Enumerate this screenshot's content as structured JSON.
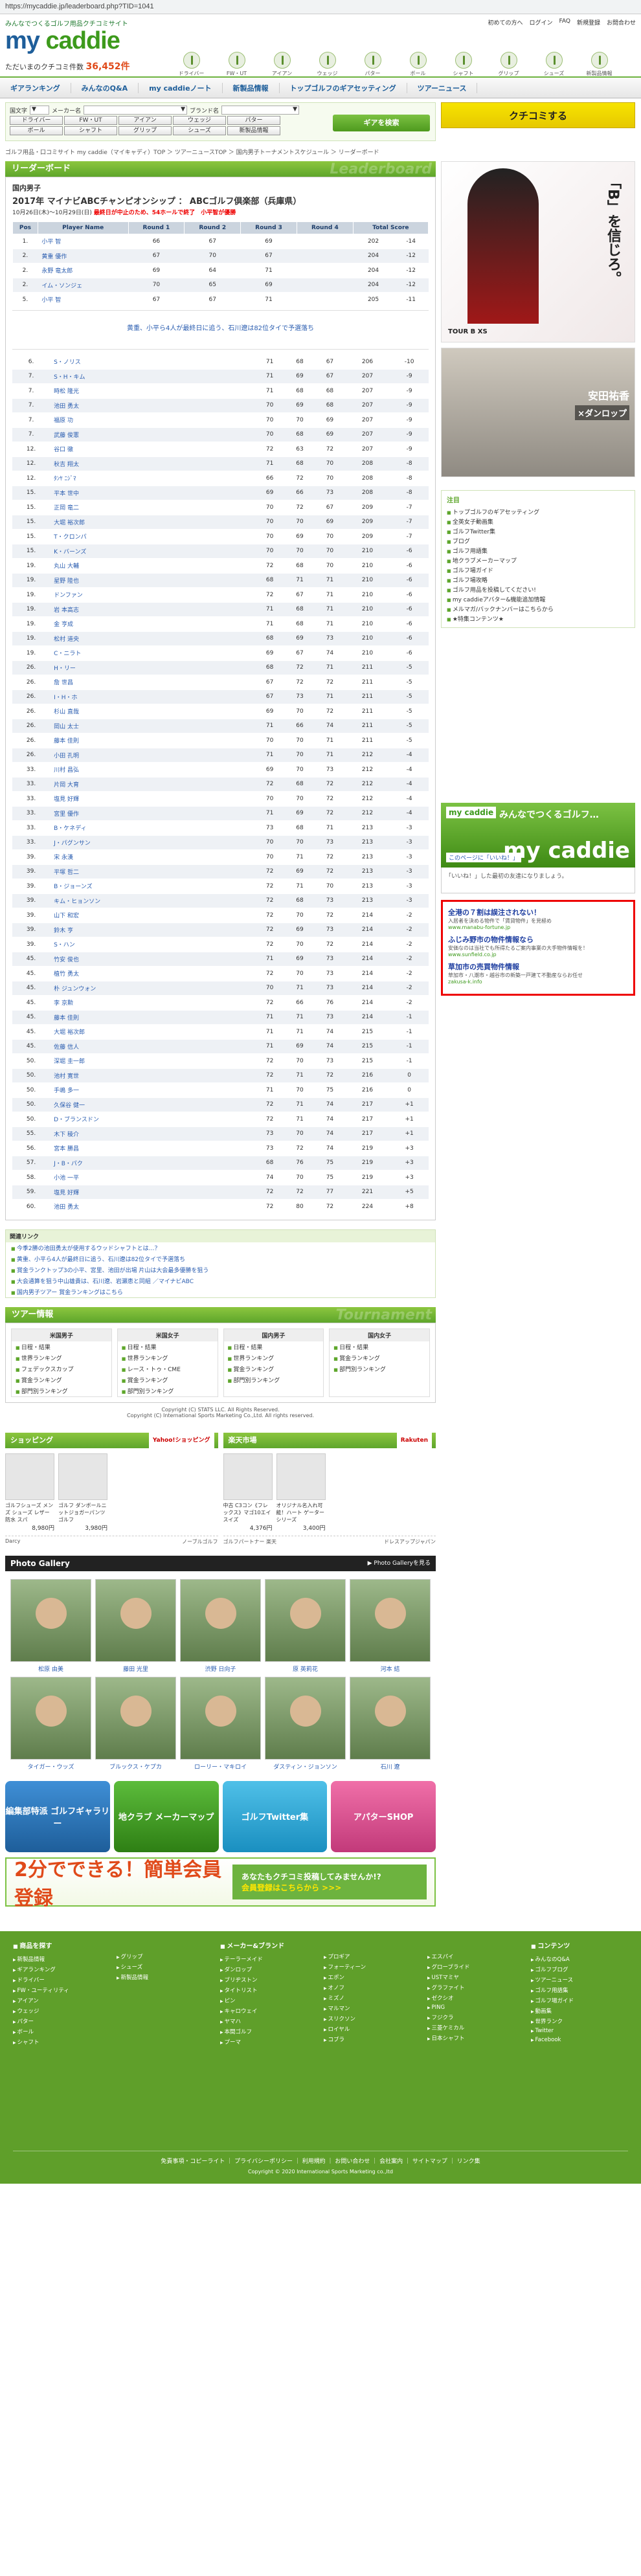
{
  "url": "https://mycaddie.jp/leaderboard.php?TID=1041",
  "header": {
    "tagline": "みんなでつくるゴルフ用品クチコミサイト",
    "logo_a": "my",
    "logo_b": "caddie",
    "posts_label": "ただいまのクチコミ件数",
    "posts_count": "36,452件",
    "toplinks": [
      "初めての方へ",
      "ログイン",
      "FAQ",
      "新規登録",
      "お問合わせ"
    ],
    "cats": [
      "ドライバー",
      "FW・UT",
      "アイアン",
      "ウェッジ",
      "パター",
      "ボール",
      "シャフト",
      "グリップ",
      "シューズ",
      "新製品情報"
    ]
  },
  "nav": [
    "ギアランキング",
    "みんなのQ&A",
    "my caddieノート",
    "新製品情報",
    "トップゴルフのギアセッティング",
    "ツアーニュース"
  ],
  "search": {
    "brand_label": "国文字",
    "maker_label": "メーカー名",
    "brand2_label": "ブランド名",
    "cats": [
      "ドライバー",
      "FW・UT",
      "アイアン",
      "ウェッジ",
      "パター",
      "ボール",
      "シャフト",
      "グリップ",
      "シューズ",
      "新製品情報"
    ],
    "gear_btn": "ギアを検索",
    "kuchi_btn": "クチコミする"
  },
  "breadcrumb": "ゴルフ用品・口コミサイト my caddie（マイキャディ）TOP ＞ ツアーニュースTOP ＞ 国内男子トーナメントスケジュール ＞ リーダーボード",
  "lb": {
    "title": "リーダーボード",
    "ghost": "Leaderboard",
    "tour": "国内男子",
    "event": "2017年 マイナビABCチャンピオンシップ ： ABCゴルフ倶楽部（兵庫県）",
    "date": "10月26日(木)～10月29日(日)",
    "date_note": "最終日が中止のため、54ホールで終了　小平智が優勝",
    "cols": [
      "Pos",
      "Player Name",
      "Round 1",
      "Round 2",
      "Round 3",
      "Round 4",
      "Total Score"
    ],
    "rows_top": [
      [
        "1.",
        "小平 智",
        "66",
        "67",
        "69",
        "",
        "202",
        "-14"
      ],
      [
        "2.",
        "黄重 優作",
        "67",
        "70",
        "67",
        "",
        "204",
        "-12"
      ],
      [
        "2.",
        "永野 竜太郎",
        "69",
        "64",
        "71",
        "",
        "204",
        "-12"
      ],
      [
        "2.",
        "イム・ソンジェ",
        "70",
        "65",
        "69",
        "",
        "204",
        "-12"
      ],
      [
        "5.",
        "小平 智",
        "67",
        "67",
        "71",
        "",
        "205",
        "-11"
      ]
    ],
    "note": "黄重、小平ら4人が最終日に追う、石川遼は82位タイで予選落ち",
    "rows": [
      [
        "6.",
        "S・ノリス",
        "71",
        "68",
        "67",
        "",
        "206",
        "-10"
      ],
      [
        "7.",
        "S・H・キム",
        "71",
        "69",
        "67",
        "",
        "207",
        "-9"
      ],
      [
        "7.",
        "時松 隆光",
        "71",
        "68",
        "68",
        "",
        "207",
        "-9"
      ],
      [
        "7.",
        "池田 勇太",
        "70",
        "69",
        "68",
        "",
        "207",
        "-9"
      ],
      [
        "7.",
        "福原 功",
        "70",
        "70",
        "69",
        "",
        "207",
        "-9"
      ],
      [
        "7.",
        "武藤 俊憲",
        "70",
        "68",
        "69",
        "",
        "207",
        "-9"
      ],
      [
        "12.",
        "谷口 徹",
        "72",
        "63",
        "72",
        "",
        "207",
        "-9"
      ],
      [
        "12.",
        "秋吉 翔太",
        "71",
        "68",
        "70",
        "",
        "208",
        "-8"
      ],
      [
        "12.",
        "ﾀﾝﾔ ﾆｼﾞﾏ",
        "66",
        "72",
        "70",
        "",
        "208",
        "-8"
      ],
      [
        "15.",
        "平本 世中",
        "69",
        "66",
        "73",
        "",
        "208",
        "-8"
      ],
      [
        "15.",
        "正岡 竜二",
        "70",
        "72",
        "67",
        "",
        "209",
        "-7"
      ],
      [
        "15.",
        "大堀 裕次郎",
        "70",
        "70",
        "69",
        "",
        "209",
        "-7"
      ],
      [
        "15.",
        "T・クロンパ",
        "70",
        "69",
        "70",
        "",
        "209",
        "-7"
      ],
      [
        "15.",
        "K・バーンズ",
        "70",
        "70",
        "70",
        "",
        "210",
        "-6"
      ],
      [
        "19.",
        "丸山 大輔",
        "72",
        "68",
        "70",
        "",
        "210",
        "-6"
      ],
      [
        "19.",
        "星野 陸也",
        "68",
        "71",
        "71",
        "",
        "210",
        "-6"
      ],
      [
        "19.",
        "ドンファン",
        "72",
        "67",
        "71",
        "",
        "210",
        "-6"
      ],
      [
        "19.",
        "岩 本高志",
        "71",
        "68",
        "71",
        "",
        "210",
        "-6"
      ],
      [
        "19.",
        "金 亨成",
        "71",
        "68",
        "71",
        "",
        "210",
        "-6"
      ],
      [
        "19.",
        "松村 道央",
        "68",
        "69",
        "73",
        "",
        "210",
        "-6"
      ],
      [
        "19.",
        "C・ニラト",
        "69",
        "67",
        "74",
        "",
        "210",
        "-6"
      ],
      [
        "26.",
        "H・リー",
        "68",
        "72",
        "71",
        "",
        "211",
        "-5"
      ],
      [
        "26.",
        "詹 世昌",
        "67",
        "72",
        "72",
        "",
        "211",
        "-5"
      ],
      [
        "26.",
        "I・H・ホ",
        "67",
        "73",
        "71",
        "",
        "211",
        "-5"
      ],
      [
        "26.",
        "杉山 直哉",
        "69",
        "70",
        "72",
        "",
        "211",
        "-5"
      ],
      [
        "26.",
        "岡山 太士",
        "71",
        "66",
        "74",
        "",
        "211",
        "-5"
      ],
      [
        "26.",
        "藤本 佳則",
        "70",
        "70",
        "71",
        "",
        "211",
        "-5"
      ],
      [
        "26.",
        "小田 孔明",
        "71",
        "70",
        "71",
        "",
        "212",
        "-4"
      ],
      [
        "33.",
        "川村 昌弘",
        "69",
        "70",
        "73",
        "",
        "212",
        "-4"
      ],
      [
        "33.",
        "片岡 大育",
        "72",
        "68",
        "72",
        "",
        "212",
        "-4"
      ],
      [
        "33.",
        "塩見 好輝",
        "70",
        "70",
        "72",
        "",
        "212",
        "-4"
      ],
      [
        "33.",
        "宮里 優作",
        "71",
        "69",
        "72",
        "",
        "212",
        "-4"
      ],
      [
        "33.",
        "B・ケネディ",
        "73",
        "68",
        "71",
        "",
        "213",
        "-3"
      ],
      [
        "33.",
        "J・パグンサン",
        "70",
        "70",
        "73",
        "",
        "213",
        "-3"
      ],
      [
        "39.",
        "宋 永漢",
        "70",
        "71",
        "72",
        "",
        "213",
        "-3"
      ],
      [
        "39.",
        "平塚 哲二",
        "72",
        "69",
        "72",
        "",
        "213",
        "-3"
      ],
      [
        "39.",
        "B・ジョーンズ",
        "72",
        "71",
        "70",
        "",
        "213",
        "-3"
      ],
      [
        "39.",
        "キム・ヒョンソン",
        "72",
        "68",
        "73",
        "",
        "213",
        "-3"
      ],
      [
        "39.",
        "山下 和宏",
        "72",
        "70",
        "72",
        "",
        "214",
        "-2"
      ],
      [
        "39.",
        "鈴木 亨",
        "72",
        "69",
        "73",
        "",
        "214",
        "-2"
      ],
      [
        "39.",
        "S・ハン",
        "72",
        "70",
        "72",
        "",
        "214",
        "-2"
      ],
      [
        "45.",
        "竹安 俊也",
        "71",
        "69",
        "73",
        "",
        "214",
        "-2"
      ],
      [
        "45.",
        "植竹 勇太",
        "72",
        "70",
        "73",
        "",
        "214",
        "-2"
      ],
      [
        "45.",
        "朴 ジュンウォン",
        "70",
        "71",
        "73",
        "",
        "214",
        "-2"
      ],
      [
        "45.",
        "李 京勲",
        "72",
        "66",
        "76",
        "",
        "214",
        "-2"
      ],
      [
        "45.",
        "藤本 佳則",
        "71",
        "71",
        "73",
        "",
        "214",
        "-1"
      ],
      [
        "45.",
        "大堀 裕次郎",
        "71",
        "71",
        "74",
        "",
        "215",
        "-1"
      ],
      [
        "45.",
        "佐藤 信人",
        "71",
        "69",
        "74",
        "",
        "215",
        "-1"
      ],
      [
        "50.",
        "深堀 圭一郎",
        "72",
        "70",
        "73",
        "",
        "215",
        "-1"
      ],
      [
        "50.",
        "池村 寛世",
        "72",
        "71",
        "72",
        "",
        "216",
        "0"
      ],
      [
        "50.",
        "手嶋 多一",
        "71",
        "70",
        "75",
        "",
        "216",
        "0"
      ],
      [
        "50.",
        "久保谷 健一",
        "72",
        "71",
        "74",
        "",
        "217",
        "+1"
      ],
      [
        "50.",
        "D・ブランスドン",
        "72",
        "71",
        "74",
        "",
        "217",
        "+1"
      ],
      [
        "55.",
        "木下 稜介",
        "73",
        "70",
        "74",
        "",
        "217",
        "+1"
      ],
      [
        "56.",
        "宮本 勝昌",
        "73",
        "72",
        "74",
        "",
        "219",
        "+3"
      ],
      [
        "57.",
        "J・B・パク",
        "68",
        "76",
        "75",
        "",
        "219",
        "+3"
      ],
      [
        "58.",
        "小池 一平",
        "74",
        "70",
        "75",
        "",
        "219",
        "+3"
      ],
      [
        "59.",
        "塩見 好輝",
        "72",
        "72",
        "77",
        "",
        "221",
        "+5"
      ],
      [
        "60.",
        "池田 勇太",
        "72",
        "80",
        "72",
        "",
        "224",
        "+8"
      ]
    ]
  },
  "related": {
    "title": "関連リンク",
    "items": [
      "今季2勝の池田勇太が使用するウッドシャフトとは…？",
      "黄重、小平ら4人が最終日に追う、石川遼は82位タイで予選落ち",
      "賞金ランクトップ3の小平、宮里、池田が出場 片山は大会最多優勝を狙う",
      "大会通算を狙う中山雄貴は、石川遼、岩瀬恵と同組 ／マイナビABC",
      "国内男子ツアー 賞金ランキングはこちら"
    ]
  },
  "tour": {
    "title": "ツアー情報",
    "ghost": "Tournament",
    "boxes": [
      {
        "h": "米国男子",
        "items": [
          "日程・結果",
          "世界ランキング",
          "フェデックスカップ",
          "賞金ランキング",
          "部門別ランキング"
        ]
      },
      {
        "h": "米国女子",
        "items": [
          "日程・結果",
          "世界ランキング",
          "レース・トゥ・CME",
          "賞金ランキング",
          "部門別ランキング"
        ]
      },
      {
        "h": "国内男子",
        "items": [
          "日程・結果",
          "世界ランキング",
          "賞金ランキング",
          "部門別ランキング"
        ]
      },
      {
        "h": "国内女子",
        "items": [
          "日程・結果",
          "賞金ランキング",
          "部門別ランキング"
        ]
      }
    ],
    "copy1": "Copyright (C) STATS LLC. All Rights Reserved.",
    "copy2": "Copyright (C) International Sports Marketing Co.,Ltd. All rights reserved."
  },
  "shop1": {
    "title": "ショッピング",
    "logo": "Yahoo!ショッピング",
    "items": [
      {
        "n": "ゴルフシューズ メンズ シューズ レザー 防水 スパ",
        "p": "8,980円"
      },
      {
        "n": "ゴルフ ダンボールニットジョガーパンツ ゴルフ",
        "p": "3,980円"
      }
    ],
    "foot_l": "Darcy",
    "foot_r": "ノーブルゴルフ"
  },
  "shop2": {
    "title": "楽天市場",
    "logo": "Rakuten",
    "items": [
      {
        "n": "中古 C3コン《フレックス》マゴ10エイスイズ",
        "p": "4,376円"
      },
      {
        "n": "オリジナル名入れ可能！ハート ゲーターシリーズ",
        "p": "3,400円"
      }
    ],
    "foot_l": "ゴルフパートナー 楽天",
    "foot_r": "ドレスアップジャパン"
  },
  "gallery": {
    "title": "Photo Gallery",
    "more": "▶ Photo Galleryを見る",
    "people": [
      "松原 由美",
      "藤田 光里",
      "渋野 日向子",
      "原 英莉花",
      "河本 結",
      "タイガー・ウッズ",
      "ブルックス・ケプカ",
      "ローリー・マキロイ",
      "ダスティン・ジョンソン",
      "石川 遼"
    ]
  },
  "banners": [
    "編集部特派 ゴルフギャラリー",
    "地クラブ メーカーマップ",
    "ゴルフTwitter集",
    "アパターSHOP"
  ],
  "reg": {
    "big": "2分でできる！簡単会員登録",
    "right1": "あなたもクチコミ投稿してみませんか!?",
    "right2": "会員登録はこちらから >>>"
  },
  "side": {
    "ad1_text": "「B」を信じろ。",
    "ad1_brand": "TOUR B XS",
    "ad2_name": "安田祐香",
    "ad2_sub": "×ダンロップ",
    "chu_title": "注目",
    "chu": [
      "トップゴルフのギアセッティング",
      "全英女子動画集",
      "ゴルフTwitter集",
      "ブログ",
      "ゴルフ用語集",
      "地クラブメーカーマップ",
      "ゴルフ場ガイド",
      "ゴルフ場攻略",
      "ゴルフ用品を投稿してください!",
      "my caddieアバター&機能追加情報",
      "メルマガ/バックナンバーはこちらから",
      "★特集コンテンツ★"
    ],
    "mc_a": "my caddie",
    "mc_b": "みんなでつくるゴルフ…",
    "mc_c": "my caddie",
    "mc_d": "このページに「いいね！」",
    "mc_rec": "「いいね！」した最初の友達になりましょう。",
    "ads": [
      {
        "t": "全港の７割は誤注されない！",
        "s": "入居者を決める物件で「賃貸物件」を見極め",
        "u": "www.manabu-fortune.jp"
      },
      {
        "t": "ふじみ野市の物件情報なら",
        "s": "安価なのは当社でも所得たるご案内事業の大手物件情報を！",
        "u": "www.sunfield.co.jp"
      },
      {
        "t": "草加市の売買物件情報",
        "s": "草加市・八潮市・越谷市の新築一戸建て不動産ならお任せ",
        "u": "zakusa-k.info"
      }
    ]
  },
  "footer": {
    "cols": [
      {
        "h": "商品を探す",
        "items": [
          "新製品情報",
          "ギアランキング",
          "ドライバー",
          "FW・ユーティリティ",
          "アイアン",
          "ウェッジ",
          "パター",
          "ボール",
          "シャフト"
        ]
      },
      {
        "h": "",
        "items": [
          "グリップ",
          "シューズ",
          "新製品情報"
        ]
      },
      {
        "h": "メーカー&ブランド",
        "items": [
          "テーラーメイド",
          "ダンロップ",
          "ブリヂストン",
          "タイトリスト",
          "ピン",
          "キャロウェイ",
          "ヤマハ",
          "本間ゴルフ",
          "プーマ"
        ]
      },
      {
        "h": "",
        "items": [
          "プロギア",
          "フォーティーン",
          "エポン",
          "オノフ",
          "ミズノ",
          "マルマン",
          "スリクソン",
          "ロイヤル",
          "コブラ"
        ]
      },
      {
        "h": "",
        "items": [
          "エスパイ",
          "グローブライド",
          "USTマミヤ",
          "グラファイト",
          "ゼクシオ",
          "PING",
          "フジクラ",
          "三菱ケミカル",
          "日本シャフト"
        ]
      },
      {
        "h": "コンテンツ",
        "items": [
          "みんなのQ&A",
          "ゴルフブログ",
          "ツアーニュース",
          "ゴルフ用語集",
          "ゴルフ場ガイド",
          "動画集",
          "世界ランク",
          "Twitter",
          "Facebook"
        ]
      }
    ],
    "links": "免責事項・コピーライト ｜ プライバシーポリシー ｜ 利用規約 ｜ お問い合わせ ｜ 会社案内 ｜ サイトマップ ｜ リンク集",
    "copy": "Copyright © 2020 International Sports Marketing co.,ltd"
  }
}
